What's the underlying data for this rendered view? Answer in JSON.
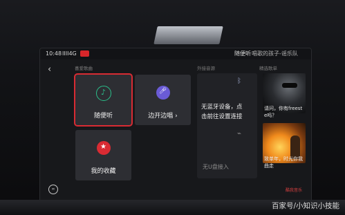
{
  "status": {
    "time": "10:48",
    "signal": "IIII4G",
    "badge": "",
    "now_playing": "随便听",
    "now_playing_sub": "唱歌的孩子-谣乐队"
  },
  "sections": {
    "mine": "喜爱歌曲",
    "external": "外接音源",
    "featured": "精选歌单"
  },
  "tiles": {
    "random": {
      "label": "随便听",
      "icon": "music-note-icon"
    },
    "sing": {
      "label": "边开边唱",
      "icon": "microphone-icon"
    },
    "favorites": {
      "label": "我的收藏",
      "icon": "star-icon"
    }
  },
  "external": {
    "bt_line1": "无蓝牙设备，点",
    "bt_line2": "击前往设置连接",
    "usb": "无U盘接入"
  },
  "playlists": [
    {
      "line1": "请问，你有freest",
      "line2": "e吗？"
    },
    {
      "line1": "致单年，时光你我",
      "line2": "曲走"
    }
  ],
  "brand": "酷我音乐",
  "watermark": "百家号/小知识小技能",
  "colors": {
    "accent_red": "#d92b33",
    "tile_bg": "#2d2e33",
    "green_ring": "#2bbf8a",
    "purple": "#6a5bd6"
  }
}
